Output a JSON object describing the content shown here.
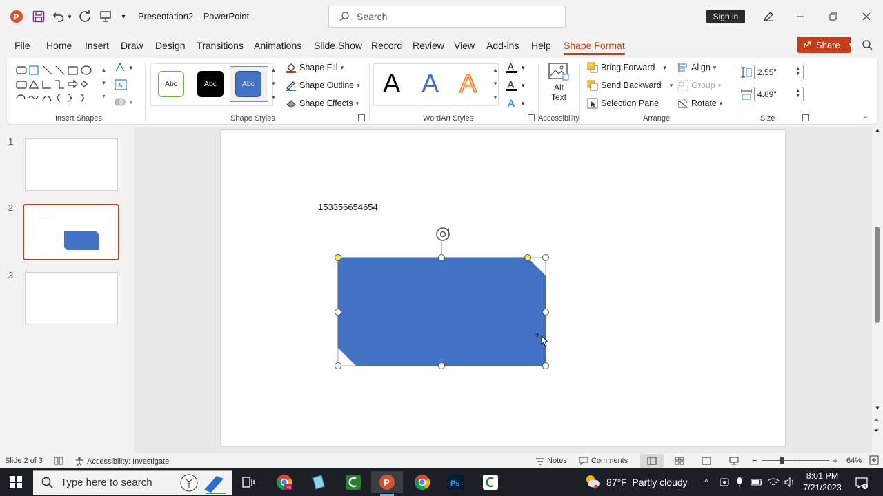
{
  "titlebar": {
    "doc_name": "Presentation2",
    "separator": "-",
    "app_name": "PowerPoint",
    "search_placeholder": "Search",
    "sign_in": "Sign in"
  },
  "menu": {
    "tabs": [
      "File",
      "Home",
      "Insert",
      "Draw",
      "Design",
      "Transitions",
      "Animations",
      "Slide Show",
      "Record",
      "Review",
      "View",
      "Add-ins",
      "Help",
      "Shape Format"
    ],
    "active_tab": "Shape Format",
    "share_label": "Share"
  },
  "ribbon": {
    "groups": {
      "insert_shapes": "Insert Shapes",
      "shape_styles": "Shape Styles",
      "wordart_styles": "WordArt Styles",
      "accessibility": "Accessibility",
      "arrange": "Arrange",
      "size": "Size"
    },
    "style_thumb_text": "Abc",
    "shape_fill": "Shape Fill",
    "shape_outline": "Shape Outline",
    "shape_effects": "Shape Effects",
    "wordart_letter": "A",
    "alt_text_line1": "Alt",
    "alt_text_line2": "Text",
    "bring_forward": "Bring Forward",
    "send_backward": "Send Backward",
    "selection_pane": "Selection Pane",
    "align": "Align",
    "group": "Group",
    "rotate": "Rotate",
    "height": "2.55\"",
    "width": "4.89\""
  },
  "slides": {
    "numbers": [
      "1",
      "2",
      "3"
    ],
    "active": 2
  },
  "slide_content": {
    "text": "153356654654",
    "shape_color": "#4472c4"
  },
  "statusbar": {
    "slide_info": "Slide 2 of 3",
    "accessibility": "Accessibility: Investigate",
    "notes": "Notes",
    "comments": "Comments",
    "zoom_minus": "−",
    "zoom_plus": "+",
    "zoom": "64%"
  },
  "taskbar": {
    "search_placeholder": "Type here to search",
    "weather": "87°F  Partly cloudy",
    "time": "8:01 PM",
    "date": "7/21/2023"
  },
  "colors": {
    "accent": "#c43e1c",
    "shape_fill": "#4472c4",
    "handle_yellow": "#f2e94e"
  }
}
